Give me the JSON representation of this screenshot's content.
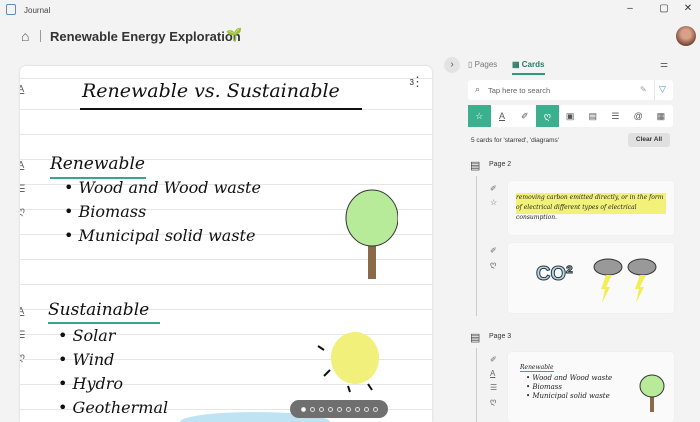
{
  "app": {
    "title": "Journal"
  },
  "window": {
    "minimize": "–",
    "maximize": "▢",
    "close": "✕"
  },
  "header": {
    "title": "Renewable Energy Exploration",
    "emoji": "🌱"
  },
  "note": {
    "page_number": "3",
    "title": "Renewable vs. Sustainable",
    "sections": [
      {
        "heading": "Renewable",
        "items": [
          "Wood and Wood waste",
          "Biomass",
          "Municipal solid waste"
        ]
      },
      {
        "heading": "Sustainable",
        "items": [
          "Solar",
          "Wind",
          "Hydro",
          "Geothermal"
        ]
      }
    ],
    "pages_total": 9,
    "current_page": 1
  },
  "panel": {
    "tabs": [
      {
        "label": "Pages"
      },
      {
        "label": "Cards",
        "active": true
      }
    ],
    "search_placeholder": "Tap here to search",
    "result_text": "5 cards for 'starred', 'diagrams'",
    "clear_all": "Clear All",
    "groups": [
      {
        "label": "Page 2",
        "cards": [
          {
            "text": "removing carbon emitted directly, or in the form of electrical different types of electrical consumption."
          },
          {
            "text": "CO²"
          }
        ]
      },
      {
        "label": "Page 3",
        "cards": [
          {
            "heading": "Renewable",
            "items": [
              "Wood and Wood waste",
              "Biomass",
              "Municipal solid waste"
            ]
          }
        ]
      }
    ]
  },
  "colors": {
    "accent": "#3bb08f",
    "highlight": "#f2f27a"
  }
}
